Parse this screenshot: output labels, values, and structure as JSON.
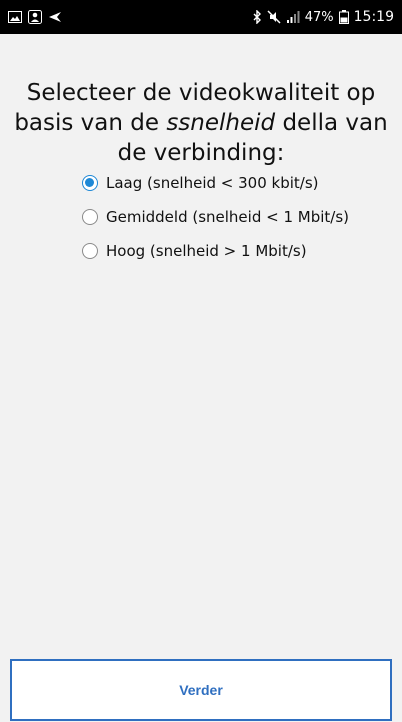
{
  "status_bar": {
    "left_icons": [
      "gallery-icon",
      "person-icon",
      "location-arrow-icon"
    ],
    "right_icons": [
      "bluetooth-icon",
      "mute-icon",
      "signal-icon",
      "battery-icon"
    ],
    "battery": "47%",
    "time": "15:19"
  },
  "question": {
    "part1": "Selecteer de videokwaliteit op basis van de ",
    "emphasis": "ssnelheid",
    "part2": " della van de verbinding:"
  },
  "options": [
    {
      "label": "Laag (snelheid < 300 kbit/s)",
      "checked": true
    },
    {
      "label": "Gemiddeld (snelheid < 1 Mbit/s)",
      "checked": false
    },
    {
      "label": "Hoog (snelheid > 1 Mbit/s)",
      "checked": false
    }
  ],
  "footer": {
    "next_label": "Verder"
  },
  "colors": {
    "accent": "#1e88d6",
    "button": "#2f6fc0",
    "background": "#f2f2f2"
  }
}
